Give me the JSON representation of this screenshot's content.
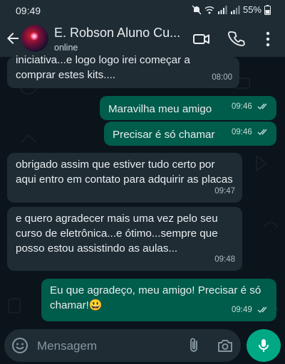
{
  "status_bar": {
    "time": "09:49",
    "battery": "55%"
  },
  "header": {
    "contact_name": "E. Robson Aluno Cu...",
    "contact_status": "online"
  },
  "messages": [
    {
      "direction": "in",
      "text": "iniciativa...e logo logo irei começar a comprar estes kits....",
      "time": "08:00"
    },
    {
      "direction": "out",
      "text": "Maravilha meu amigo",
      "time": "09:46",
      "read": true
    },
    {
      "direction": "out",
      "text": "Precisar é só chamar",
      "time": "09:46",
      "read": true
    },
    {
      "direction": "in",
      "text": "obrigado assim que estiver tudo certo por aqui entro em contato para adquirir as placas",
      "time": "09:47"
    },
    {
      "direction": "in",
      "text": "e quero agradecer mais uma vez pelo seu curso de eletrônica...e ótimo...sempre que posso estou assistindo as aulas...",
      "time": "09:48"
    },
    {
      "direction": "out",
      "text": "Eu que agradeço,  meu amigo! Precisar é só chamar!😃",
      "time": "09:49",
      "read": true
    }
  ],
  "composer": {
    "placeholder": "Mensagem"
  },
  "colors": {
    "background": "#0b141a",
    "bar": "#1f2c34",
    "incoming": "#1f2c34",
    "outgoing": "#005c4b",
    "accent": "#00a884",
    "read_ticks": "#53bdeb"
  },
  "icons": [
    "back-arrow-icon",
    "video-call-icon",
    "phone-call-icon",
    "more-options-icon",
    "emoji-icon",
    "attach-icon",
    "camera-icon",
    "mic-icon",
    "double-check-icon",
    "do-not-disturb-icon",
    "wifi-icon",
    "signal-icon",
    "battery-icon"
  ]
}
